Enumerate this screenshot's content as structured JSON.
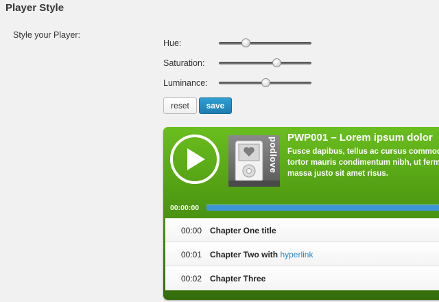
{
  "section": {
    "title": "Player Style"
  },
  "form": {
    "label": "Style your Player:",
    "sliders": [
      {
        "label": "Hue:",
        "value": 0.29
      },
      {
        "label": "Saturation:",
        "value": 0.62
      },
      {
        "label": "Luminance:",
        "value": 0.5
      }
    ],
    "reset_label": "reset",
    "save_label": "save"
  },
  "player": {
    "title": "PWP001 – Lorem ipsum dolor",
    "subtitle": "Fusce dapibus, tellus ac cursus commodo, tortor mauris condimentum nibh, ut fermentum massa justo sit amet risus.",
    "cover_text": "podlove",
    "time": "00:00:00",
    "progress": 1.0,
    "chapters": [
      {
        "time": "00:00",
        "title": "Chapter One title",
        "link": ""
      },
      {
        "time": "00:01",
        "title": "Chapter Two with",
        "link": "hyperlink"
      },
      {
        "time": "00:02",
        "title": "Chapter Three",
        "link": ""
      }
    ]
  },
  "colors": {
    "player_green": "#54a114",
    "progress_blue": "#3e95d6",
    "link_blue": "#2b86c6",
    "save_blue": "#2285bd"
  },
  "icons": {
    "play": "play-icon",
    "heart": "heart-icon"
  }
}
